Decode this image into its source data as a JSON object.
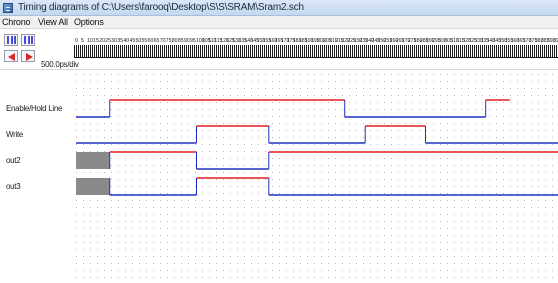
{
  "window": {
    "title": "Timing diagrams of C:\\Users\\farooq\\Desktop\\S\\S\\SRAM\\Sram2.sch"
  },
  "menu": {
    "items": [
      "Chrono",
      "View All",
      "Options"
    ]
  },
  "toolbar": {
    "scale_label": "500.0ps/div",
    "ruler_ticks": [
      "0",
      "5",
      "10",
      "15",
      "20",
      "25",
      "30",
      "35",
      "40",
      "45",
      "50",
      "55",
      "60",
      "65",
      "70",
      "75",
      "80",
      "85",
      "90",
      "95",
      "100",
      "105",
      "110",
      "115",
      "120",
      "125",
      "130",
      "135",
      "140",
      "145",
      "150",
      "155",
      "160",
      "165",
      "170",
      "175",
      "180",
      "185",
      "190",
      "195",
      "200",
      "205",
      "210",
      "215",
      "220",
      "225",
      "230",
      "235",
      "240",
      "245",
      "250",
      "255",
      "260",
      "265",
      "270",
      "275",
      "280",
      "285",
      "290",
      "295",
      "300",
      "305",
      "310",
      "315",
      "320",
      "325",
      "330",
      "335",
      "340",
      "345",
      "350",
      "355",
      "360",
      "365",
      "370",
      "375",
      "380",
      "385",
      "390",
      "395"
    ],
    "icons": {
      "zoom_in": "zoom-in-icon",
      "zoom_out": "zoom-out-icon",
      "scroll_left": "arrow-left-icon",
      "scroll_right": "arrow-right-icon"
    }
  },
  "timeline": {
    "t_start": 0,
    "t_end": 400
  },
  "colors": {
    "high": "#e02020",
    "low": "#2030c0",
    "unknown": "#8a8a8a",
    "grid_dot": "#b8b8b8"
  },
  "signals": [
    {
      "label": "Enable/Hold Line",
      "segments": [
        {
          "start": 0,
          "end": 28,
          "level": "low"
        },
        {
          "start": 28,
          "end": 223,
          "level": "high"
        },
        {
          "start": 223,
          "end": 340,
          "level": "low"
        },
        {
          "start": 340,
          "end": 360,
          "level": "high"
        }
      ]
    },
    {
      "label": "Write",
      "segments": [
        {
          "start": 0,
          "end": 100,
          "level": "low"
        },
        {
          "start": 100,
          "end": 160,
          "level": "high"
        },
        {
          "start": 160,
          "end": 240,
          "level": "low"
        },
        {
          "start": 240,
          "end": 290,
          "level": "high"
        },
        {
          "start": 290,
          "end": 400,
          "level": "low"
        }
      ]
    },
    {
      "label": "out2",
      "segments": [
        {
          "start": 0,
          "end": 28,
          "level": "unknown"
        },
        {
          "start": 28,
          "end": 100,
          "level": "high"
        },
        {
          "start": 100,
          "end": 160,
          "level": "low"
        },
        {
          "start": 160,
          "end": 400,
          "level": "high"
        }
      ]
    },
    {
      "label": "out3",
      "segments": [
        {
          "start": 0,
          "end": 28,
          "level": "unknown"
        },
        {
          "start": 28,
          "end": 100,
          "level": "low"
        },
        {
          "start": 100,
          "end": 160,
          "level": "high"
        },
        {
          "start": 160,
          "end": 400,
          "level": "low"
        }
      ]
    }
  ]
}
